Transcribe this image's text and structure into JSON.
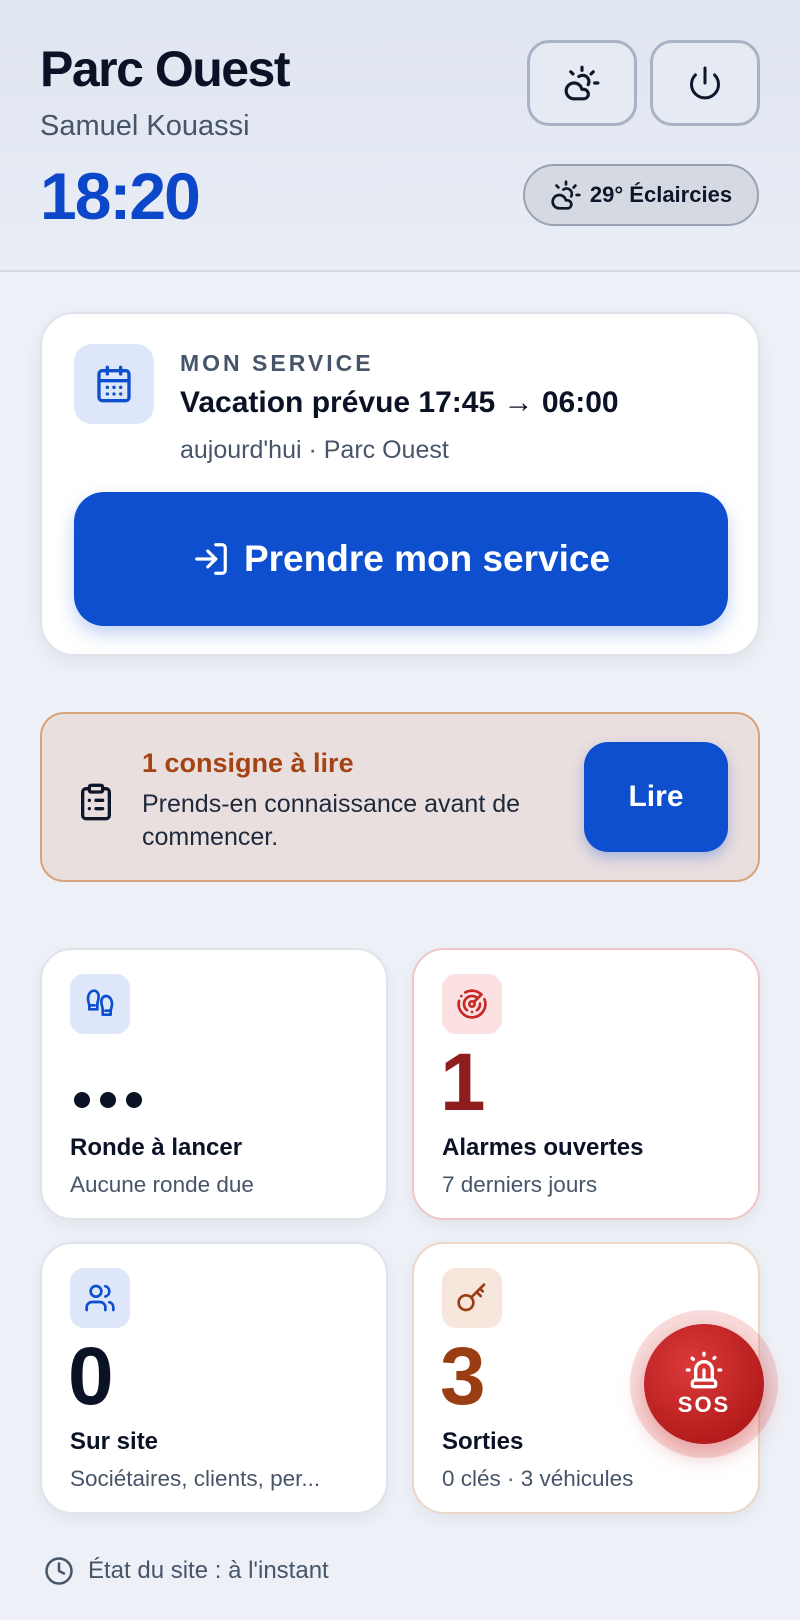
{
  "header": {
    "site": "Parc Ouest",
    "user": "Samuel Kouassi",
    "time": "18:20",
    "theme_icon": "sun-cloud-icon",
    "power_icon": "power-icon",
    "weather": {
      "icon": "partly-cloudy-icon",
      "label": "29° Éclaircies"
    }
  },
  "service": {
    "icon": "calendar-icon",
    "kicker": "MON SERVICE",
    "title": "Vacation prévue 17:45 → 06:00",
    "subtitle": "aujourd'hui · Parc Ouest",
    "button_icon": "login-arrow-icon",
    "button_label": "Prendre mon service"
  },
  "notice": {
    "icon": "clipboard-icon",
    "title": "1 consigne à lire",
    "text": "Prends-en connaissance avant de commencer.",
    "button_label": "Lire"
  },
  "tiles": [
    {
      "icon": "footprints-icon",
      "value": "",
      "label": "Ronde à lancer",
      "sub": "Aucune ronde due"
    },
    {
      "icon": "radar-icon",
      "value": "1",
      "label": "Alarmes ouvertes",
      "sub": "7 derniers jours"
    },
    {
      "icon": "users-icon",
      "value": "0",
      "label": "Sur site",
      "sub": "Sociétaires, clients, per..."
    },
    {
      "icon": "key-icon",
      "value": "3",
      "label": "Sorties",
      "sub": "0 clés · 3 véhicules"
    }
  ],
  "sos": {
    "icon": "siren-icon",
    "label": "SOS"
  },
  "footer": {
    "icon": "clock-icon",
    "text": "État du site : à l'instant"
  },
  "colors": {
    "primary": "#0d4fcf",
    "alert": "#8f1d1d",
    "warning": "#9a3d12",
    "sos": "#b51d1d"
  }
}
